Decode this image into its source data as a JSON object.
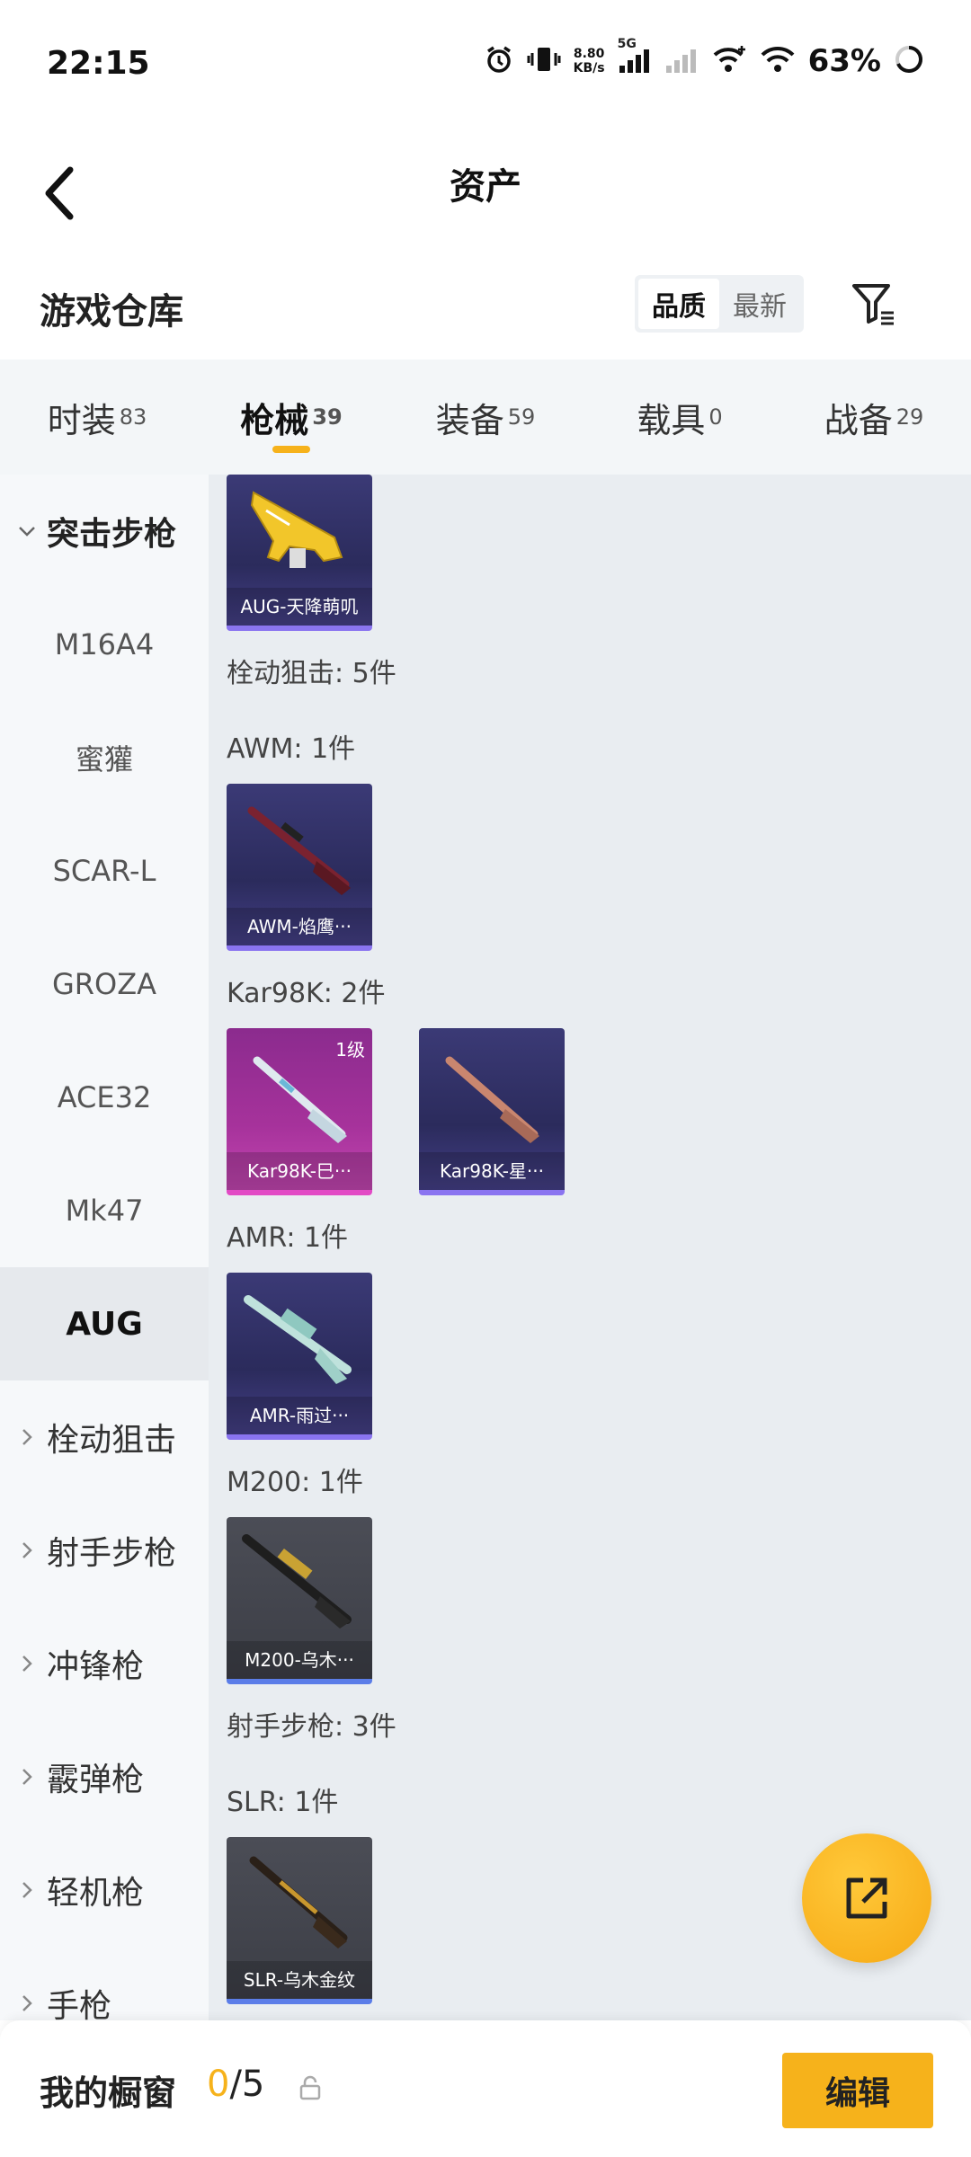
{
  "status": {
    "time": "22:15",
    "net_speed_value": "8.80",
    "net_speed_unit": "KB/s",
    "network": "5G",
    "battery": "63%"
  },
  "header": {
    "title": "资产"
  },
  "warehouse": {
    "title": "游戏仓库",
    "sort_quality": "品质",
    "sort_latest": "最新"
  },
  "tabs": [
    {
      "label": "时装",
      "count": "83"
    },
    {
      "label": "枪械",
      "count": "39"
    },
    {
      "label": "装备",
      "count": "59"
    },
    {
      "label": "载具",
      "count": "0"
    },
    {
      "label": "战备",
      "count": "29"
    }
  ],
  "sidebar": {
    "items": [
      {
        "label": "突击步枪"
      },
      {
        "label": "M16A4"
      },
      {
        "label": "蜜獾"
      },
      {
        "label": "SCAR-L"
      },
      {
        "label": "GROZA"
      },
      {
        "label": "ACE32"
      },
      {
        "label": "Mk47"
      },
      {
        "label": "AUG"
      },
      {
        "label": "栓动狙击"
      },
      {
        "label": "射手步枪"
      },
      {
        "label": "冲锋枪"
      },
      {
        "label": "霰弹枪"
      },
      {
        "label": "轻机枪"
      },
      {
        "label": "手枪"
      }
    ]
  },
  "content": {
    "aug_item": "AUG-天降萌叽",
    "bolt_group": "栓动狙击: 5件",
    "awm_group": "AWM: 1件",
    "awm_item": "AWM-焰鹰···",
    "kar_group": "Kar98K: 2件",
    "kar_item_1": "Kar98K-巳···",
    "kar_item_1_level": "1级",
    "kar_item_2": "Kar98K-星···",
    "amr_group": "AMR: 1件",
    "amr_item": "AMR-雨过···",
    "m200_group": "M200: 1件",
    "m200_item": "M200-乌木···",
    "dmr_group": "射手步枪: 3件",
    "slr_group": "SLR: 1件",
    "slr_item": "SLR-乌木金纹"
  },
  "bottom": {
    "label": "我的橱窗",
    "count_current": "0",
    "count_total": "/5",
    "edit": "编辑"
  },
  "colors": {
    "accent": "#f6b21b",
    "epic": "#8a74f0",
    "legendary": "#e24ac5",
    "rare": "#5b7de8"
  }
}
